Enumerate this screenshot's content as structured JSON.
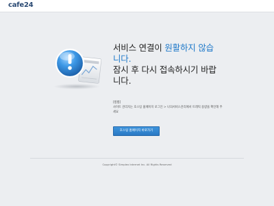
{
  "header": {
    "logo_text": "cafe",
    "logo_num": "24"
  },
  "main": {
    "title_line1_prefix": "서비스 연결이 ",
    "title_line1_highlight": "원활하지 않습",
    "title_line2_highlight": "니다.",
    "title_line3": "잠시 후 다시 접속하시기 바랍",
    "title_line4": "니다.",
    "guide_label": "[방법]",
    "guide_text": "사이트 관리자는 호스팅 홈페이지 로그인 > 나의서비스관리에서 트래픽 용량을 확인해 주세요",
    "cta_label": "호스팅 홈페이지 바로가기"
  },
  "footer": {
    "copyright": "Copyright© Simplex Internet Inc. All Rights Reserved"
  },
  "icons": {
    "illustration": "exclamation-warning-icon"
  },
  "colors": {
    "accent": "#1d78c9",
    "button": "#2a79c4",
    "background": "#eceef1"
  }
}
